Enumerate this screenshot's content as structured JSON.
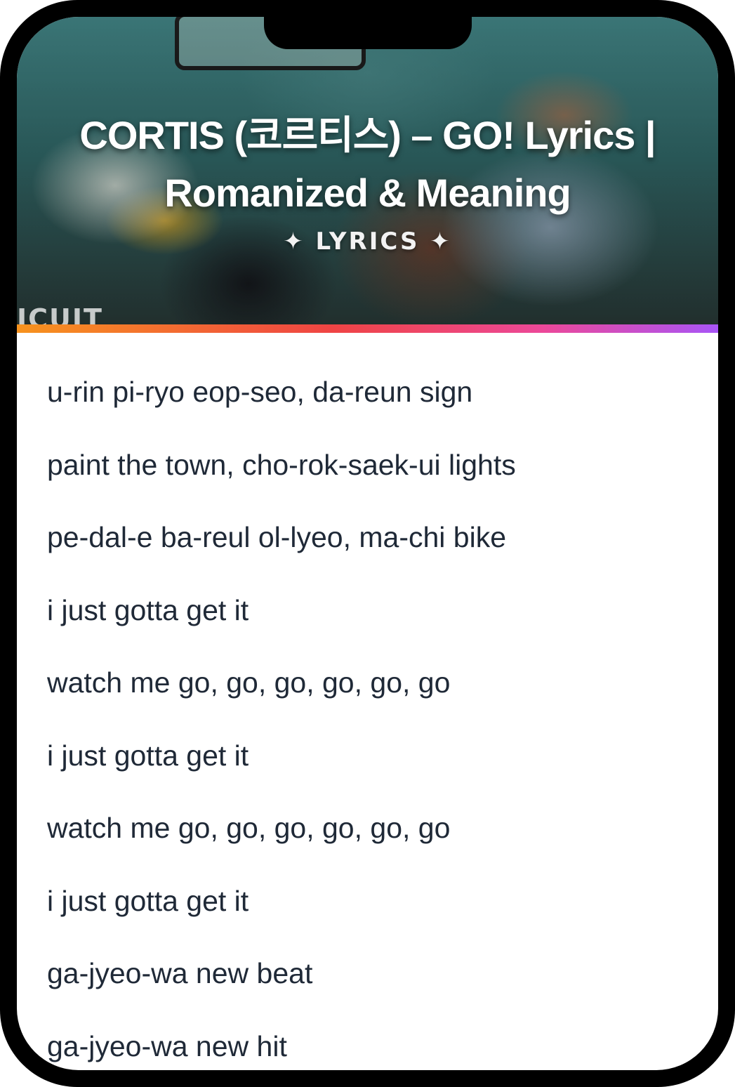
{
  "header": {
    "title": "CORTIS (코르티스) – GO! Lyrics | Romanized & Meaning",
    "tag": "✦ LYRICS ✦",
    "watermark": "ICUIT"
  },
  "colors": {
    "accent_gradient": [
      "#f7931e",
      "#ef4444",
      "#ec4899",
      "#a855f7"
    ],
    "lyric_text": "#1f2937"
  },
  "lyrics": [
    "u-rin pi-ryo eop-seo, da-reun sign",
    "paint the town, cho-rok-saek-ui lights",
    "pe-dal-e ba-reul ol-lyeo, ma-chi bike",
    "i just gotta get it",
    "watch me go, go, go, go, go, go",
    "i just gotta get it",
    "watch me go, go, go, go, go, go",
    "i just gotta get it",
    "ga-jyeo-wa new beat",
    "ga-jyeo-wa new hit"
  ]
}
